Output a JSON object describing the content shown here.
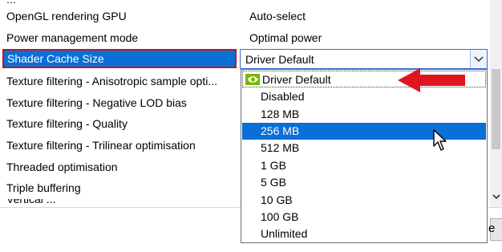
{
  "settings": {
    "partial_top_feature": "...",
    "rows": [
      {
        "feature": "OpenGL rendering GPU",
        "value": "Auto-select"
      },
      {
        "feature": "Power management mode",
        "value": "Optimal power"
      },
      {
        "feature": "Shader Cache Size",
        "value": "Driver Default"
      },
      {
        "feature": "Texture filtering - Anisotropic sample opti..."
      },
      {
        "feature": "Texture filtering - Negative LOD bias"
      },
      {
        "feature": "Texture filtering - Quality"
      },
      {
        "feature": "Texture filtering - Trilinear optimisation"
      },
      {
        "feature": "Threaded optimisation"
      },
      {
        "feature": "Triple buffering"
      },
      {
        "feature": "Vertical ..."
      }
    ]
  },
  "dropdown": {
    "options": [
      "Driver Default",
      "Disabled",
      "128 MB",
      "256 MB",
      "512 MB",
      "1 GB",
      "5 GB",
      "10 GB",
      "100 GB",
      "Unlimited"
    ],
    "highlighted": "256 MB"
  },
  "bottom_button_fragment": "e",
  "colors": {
    "selection": "#0a6fd6",
    "highlight_border": "#c8141e",
    "arrow": "#e0141e",
    "nvidia_green": "#76b900"
  },
  "icons": {
    "combo_arrow": "chevron-down-icon",
    "nvidia_logo": "nvidia-logo-icon",
    "annotation_arrow": "red-arrow-icon",
    "mouse": "mouse-pointer-icon"
  }
}
